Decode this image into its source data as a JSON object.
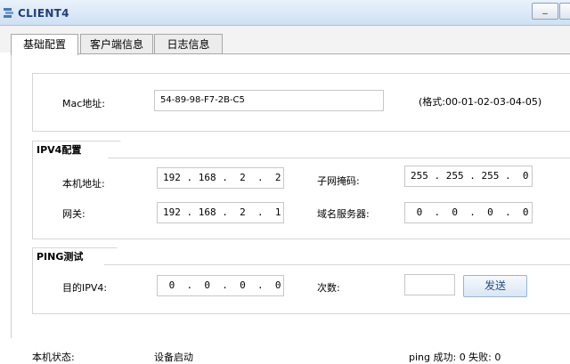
{
  "window": {
    "title": "CLIENT4",
    "minimize_label": "_"
  },
  "tabs": [
    {
      "label": "基础配置",
      "active": true
    },
    {
      "label": "客户端信息",
      "active": false
    },
    {
      "label": "日志信息",
      "active": false
    }
  ],
  "mac": {
    "label": "Mac地址:",
    "value": "54-89-98-F7-2B-C5",
    "hint": "(格式:00-01-02-03-04-05)"
  },
  "ipv4": {
    "group_label": "IPV4配置",
    "ip_label": "本机地址:",
    "ip_value": "192 . 168 .  2  .  2",
    "mask_label": "子网掩码:",
    "mask_value": "255 . 255 . 255 .  0",
    "gateway_label": "网关:",
    "gateway_value": "192 . 168 .  2  .  1",
    "dns_label": "域名服务器:",
    "dns_value": " 0  .  0  .  0  .  0"
  },
  "ping": {
    "group_label": "PING测试",
    "target_label": "目的IPV4:",
    "target_value": " 0  .  0  .  0  .  0",
    "count_label": "次数:",
    "count_value": "",
    "send_label": "发送"
  },
  "status": {
    "label": "本机状态:",
    "value": "设备启动",
    "ping_result": "ping 成功: 0 失败: 0"
  },
  "colors": {
    "title_text": "#1e3f7a",
    "button_text": "#264d88"
  }
}
